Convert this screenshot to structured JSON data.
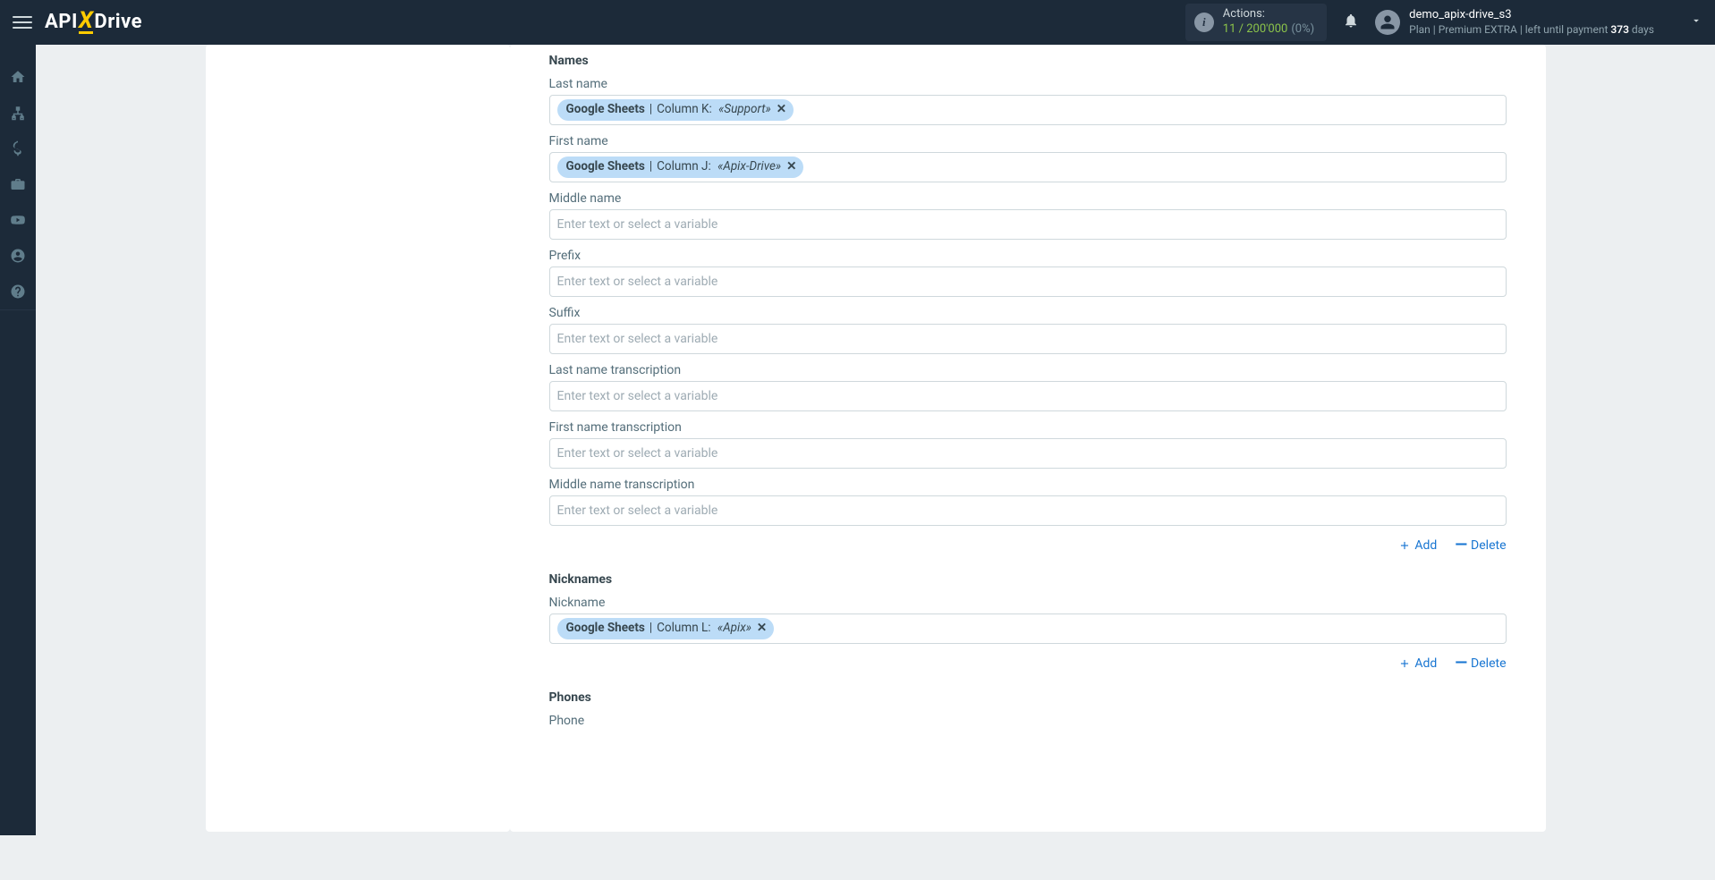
{
  "header": {
    "logo": {
      "part1": "API",
      "part2": "X",
      "part3": "Drive"
    },
    "actions": {
      "label": "Actions:",
      "used": "11",
      "sep": " / ",
      "limit": "200'000",
      "pct": "(0%)"
    },
    "user": {
      "name": "demo_apix-drive_s3",
      "plan_prefix": "Plan  | ",
      "plan_name": "Premium EXTRA",
      "plan_mid": " |  left until payment ",
      "days_num": "373",
      "days_word": " days"
    }
  },
  "form": {
    "placeholder": "Enter text or select a variable",
    "add": "Add",
    "delete": "Delete",
    "sections": {
      "names": {
        "title": "Names",
        "fields": {
          "last_name": {
            "label": "Last name",
            "chip": {
              "src": "Google Sheets",
              "col": "Column K:",
              "val": "«Support»"
            }
          },
          "first_name": {
            "label": "First name",
            "chip": {
              "src": "Google Sheets",
              "col": "Column J:",
              "val": "«Apix-Drive»"
            }
          },
          "middle_name": {
            "label": "Middle name"
          },
          "prefix": {
            "label": "Prefix"
          },
          "suffix": {
            "label": "Suffix"
          },
          "last_name_tr": {
            "label": "Last name transcription"
          },
          "first_name_tr": {
            "label": "First name transcription"
          },
          "middle_name_tr": {
            "label": "Middle name transcription"
          }
        }
      },
      "nicknames": {
        "title": "Nicknames",
        "fields": {
          "nickname": {
            "label": "Nickname",
            "chip": {
              "src": "Google Sheets",
              "col": "Column L:",
              "val": "«Apix»"
            }
          }
        }
      },
      "phones": {
        "title": "Phones",
        "fields": {
          "phone": {
            "label": "Phone"
          }
        }
      }
    }
  }
}
